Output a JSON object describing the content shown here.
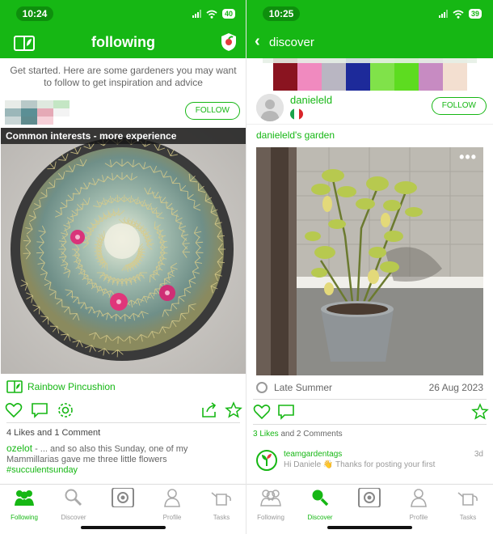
{
  "left": {
    "status": {
      "time": "10:24",
      "battery": "40"
    },
    "nav": {
      "title": "following"
    },
    "intro": "Get started. Here are some gardeners you may want to follow to get inspiration and advice",
    "follow_label": "FOLLOW",
    "banner": "Common interests - more experience",
    "plant_name": "Rainbow Pincushion",
    "likes_text": "4 Likes and 1 Comment",
    "comment": {
      "user": "ozelot",
      "text": " - ... and so also this Sunday, one of my Mammillarias gave me three little flowers",
      "hashtag": "#succulentsunday"
    },
    "tabs": [
      {
        "label": "Following",
        "icon": "people-icon",
        "active": true
      },
      {
        "label": "Discover",
        "icon": "magnifier-icon",
        "active": false
      },
      {
        "label": "",
        "icon": "camera-icon",
        "active": false
      },
      {
        "label": "Profile",
        "icon": "person-icon",
        "active": false
      },
      {
        "label": "Tasks",
        "icon": "watering-can-icon",
        "active": false
      }
    ]
  },
  "right": {
    "status": {
      "time": "10:25",
      "battery": "39"
    },
    "nav": {
      "back_label": "discover"
    },
    "username": "danieleld",
    "follow_label": "FOLLOW",
    "garden_title": "danieleld's garden",
    "more_label": "•••",
    "season": "Late Summer",
    "date": "26 Aug 2023",
    "likes": {
      "count": "3 Likes",
      "rest": " and 2 Comments"
    },
    "comment": {
      "user": "teamgardentags",
      "age": "3d",
      "text": "Hi Daniele 👋 Thanks for posting your first"
    },
    "tabs": [
      {
        "label": "Following",
        "icon": "people-icon",
        "active": false
      },
      {
        "label": "Discover",
        "icon": "magnifier-icon",
        "active": true
      },
      {
        "label": "",
        "icon": "camera-icon",
        "active": false
      },
      {
        "label": "Profile",
        "icon": "person-icon",
        "active": false
      },
      {
        "label": "Tasks",
        "icon": "watering-can-icon",
        "active": false
      }
    ]
  },
  "colors": {
    "brand": "#16b714",
    "brand_dark": "#0e8f0d",
    "text_muted": "#666666"
  }
}
